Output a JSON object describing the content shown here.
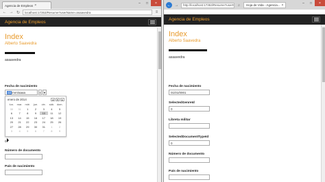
{
  "left_browser": {
    "tab_title": "Agencia de Empleos",
    "url": "localhost:17353/Resume?userName=asaavedra",
    "brand": "Agencia de Empleos",
    "page_title": "Index",
    "page_subtitle": "Alberto Saavedra",
    "username": "asaavedra",
    "fecha_label": "Fecha de nacimiento",
    "date_input_value": "dd/mm/aaaa",
    "datepicker": {
      "month": "enero de 2014",
      "dow": [
        "lun.",
        "mar.",
        "mié.",
        "jue.",
        "vie.",
        "sáb.",
        "dom."
      ],
      "weeks": [
        [
          "30",
          "31",
          "1",
          "2",
          "3",
          "4",
          "5"
        ],
        [
          "6",
          "7",
          "8",
          "9",
          "10",
          "11",
          "12"
        ],
        [
          "13",
          "14",
          "15",
          "16",
          "17",
          "18",
          "19"
        ],
        [
          "20",
          "21",
          "22",
          "23",
          "24",
          "25",
          "26"
        ],
        [
          "27",
          "28",
          "29",
          "30",
          "31",
          "1",
          "2"
        ],
        [
          "3",
          "4",
          "5",
          "6",
          "7",
          "8",
          "9"
        ]
      ]
    },
    "zero_value": "0",
    "numero_label": "Número de documento",
    "pais_label": "País de nacimiento"
  },
  "right_browser": {
    "url": "http://localhost:17353/Resume?userName=asaavedra",
    "tab_title": "Hoja de Vida - Agencia...",
    "brand": "Agencia de Empleos",
    "page_title": "Index",
    "page_subtitle": "Alberto Saavedra",
    "username": "asaavedra",
    "fecha_label": "Fecha de nacimiento",
    "fecha_value": "01/01/0001",
    "genre_label": "SelectedGenreId",
    "genre_value": "0",
    "libreta_label": "Libreta militar",
    "doctype_label": "SelectedDocumentTypeId",
    "doctype_value": "0",
    "numero_label": "Número de documento",
    "pais_label": "País de nacimiento"
  }
}
